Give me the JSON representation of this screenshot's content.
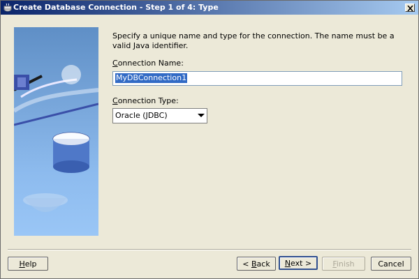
{
  "window": {
    "title": "Create Database Connection - Step 1 of 4: Type",
    "close_label": "Close"
  },
  "form": {
    "instructions": "Specify a unique name and type for the connection. The name must be a valid Java identifier.",
    "connection_name": {
      "label_prefix": "C",
      "label_rest": "onnection Name:",
      "value": "MyDBConnection1"
    },
    "connection_type": {
      "label_prefix": "C",
      "label_rest": "onnection Type:",
      "selected": "Oracle (JDBC)"
    }
  },
  "buttons": {
    "help": {
      "prefix": "H",
      "rest": "elp"
    },
    "back": {
      "prefix": "< ",
      "mnemonic": "B",
      "rest": "ack"
    },
    "next": {
      "prefix": "",
      "mnemonic": "N",
      "rest": "ext >"
    },
    "finish": {
      "prefix": "",
      "mnemonic": "F",
      "rest": "inish"
    },
    "cancel": {
      "label": "Cancel"
    }
  },
  "icons": {
    "title_icon": "coffee-cup-icon",
    "close_icon": "close-x-icon"
  }
}
